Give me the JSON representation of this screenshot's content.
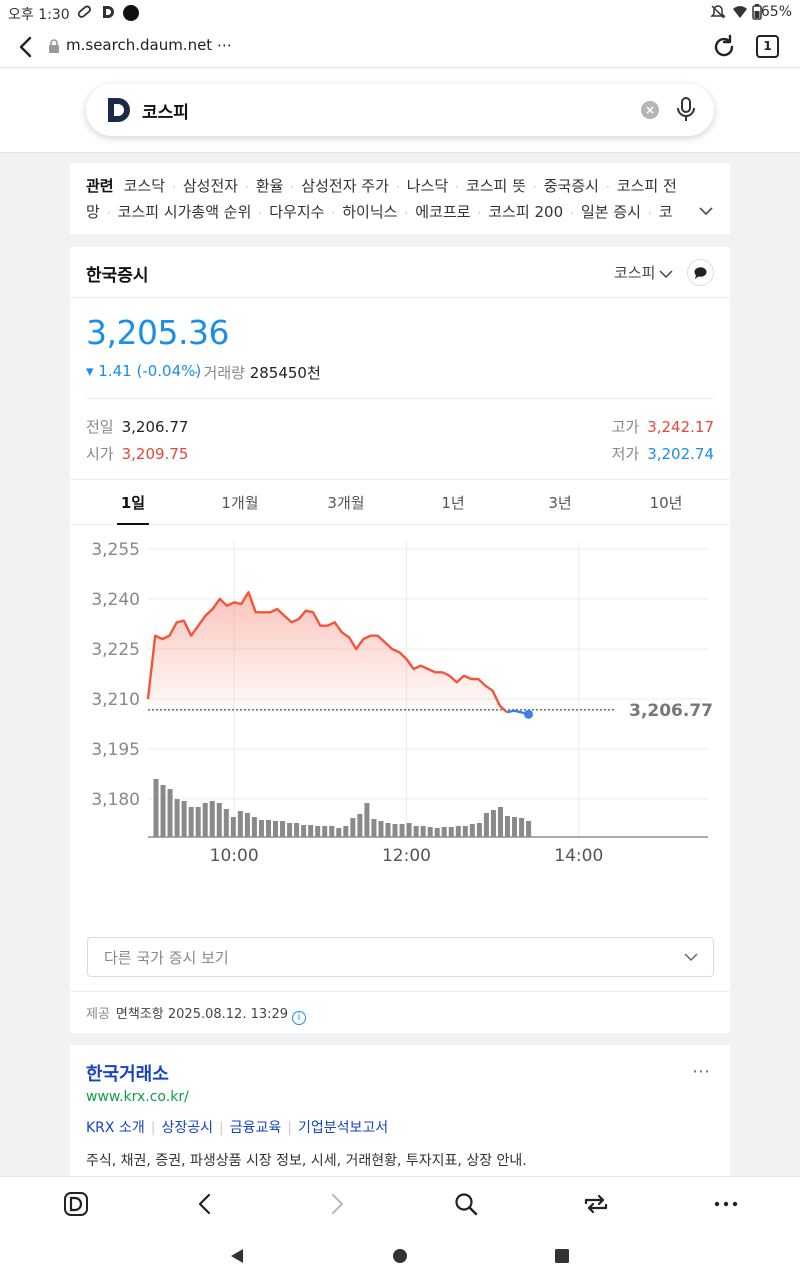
{
  "status_bar": {
    "time": "오후 1:30",
    "battery": "65%"
  },
  "browser": {
    "url": "m.search.daum.net ⋯",
    "tab_count": "1"
  },
  "search": {
    "query": "코스피"
  },
  "related": {
    "label": "관련",
    "line1": [
      "코스닥",
      "삼성전자",
      "환율",
      "삼성전자 주가",
      "나스닥",
      "코스피 뜻",
      "중국증시",
      "코스피 전"
    ],
    "line2": [
      "망",
      "코스피 시가총액 순위",
      "다우지수",
      "하이닉스",
      "에코프로",
      "코스피 200",
      "일본 증시",
      "코"
    ]
  },
  "market": {
    "title": "한국증시",
    "index_selector": "코스피",
    "price": "3,205.36",
    "change": "▾ 1.41 (-0.04%)",
    "volume_label": "· 거래량",
    "volume_value": "285450천",
    "prev_close_label": "전일",
    "prev_close": "3,206.77",
    "open_label": "시가",
    "open": "3,209.75",
    "high_label": "고가",
    "high": "3,242.17",
    "low_label": "저가",
    "low": "3,202.74",
    "tabs": [
      "1일",
      "1개월",
      "3개월",
      "1년",
      "3년",
      "10년"
    ],
    "other_markets": "다른 국가 증시 보기",
    "provider_label": "제공",
    "provider_value": "면책조항 2025.08.12. 13:29"
  },
  "chart_data": {
    "type": "line",
    "x_ticks": [
      "10:00",
      "12:00",
      "14:00"
    ],
    "y_ticks": [
      "3,255",
      "3,240",
      "3,225",
      "3,210",
      "3,195",
      "3,180"
    ],
    "ylim": [
      3180,
      3255
    ],
    "x_range_minutes": [
      540,
      930
    ],
    "reference_label": "3,206.77",
    "reference_value": 3206.77,
    "series": [
      {
        "points": [
          [
            540,
            3210
          ],
          [
            545,
            3229
          ],
          [
            550,
            3228
          ],
          [
            555,
            3229
          ],
          [
            560,
            3233
          ],
          [
            565,
            3233.5
          ],
          [
            570,
            3229
          ],
          [
            575,
            3232
          ],
          [
            580,
            3235
          ],
          [
            585,
            3237
          ],
          [
            590,
            3240
          ],
          [
            595,
            3238
          ],
          [
            600,
            3239
          ],
          [
            605,
            3238.5
          ],
          [
            610,
            3242
          ],
          [
            615,
            3236
          ],
          [
            620,
            3236
          ],
          [
            625,
            3236
          ],
          [
            630,
            3237
          ],
          [
            635,
            3235
          ],
          [
            640,
            3233
          ],
          [
            645,
            3234
          ],
          [
            650,
            3236.5
          ],
          [
            655,
            3236
          ],
          [
            660,
            3232
          ],
          [
            665,
            3232
          ],
          [
            670,
            3233
          ],
          [
            675,
            3230
          ],
          [
            680,
            3228.5
          ],
          [
            685,
            3225
          ],
          [
            690,
            3228
          ],
          [
            695,
            3229
          ],
          [
            700,
            3229
          ],
          [
            705,
            3227
          ],
          [
            710,
            3225
          ],
          [
            715,
            3224
          ],
          [
            720,
            3222
          ],
          [
            725,
            3219
          ],
          [
            730,
            3220
          ],
          [
            735,
            3219
          ],
          [
            740,
            3218
          ],
          [
            745,
            3218
          ],
          [
            750,
            3217
          ],
          [
            755,
            3215
          ],
          [
            760,
            3217
          ],
          [
            765,
            3216
          ],
          [
            770,
            3216
          ],
          [
            775,
            3214
          ],
          [
            780,
            3212.5
          ],
          [
            785,
            3208
          ],
          [
            790,
            3206
          ],
          [
            795,
            3206.5
          ],
          [
            800,
            3206
          ],
          [
            805,
            3205.4
          ]
        ]
      }
    ],
    "volume": [
      58,
      52,
      48,
      38,
      36,
      30,
      30,
      34,
      36,
      34,
      28,
      20,
      26,
      24,
      20,
      17,
      17,
      16,
      16,
      14,
      14,
      12,
      12,
      11,
      11,
      11,
      9,
      11,
      19,
      23,
      34,
      18,
      16,
      14,
      13,
      13,
      14,
      11,
      11,
      10,
      9,
      10,
      10,
      11,
      11,
      13,
      14,
      24,
      27,
      30,
      21,
      20,
      19,
      16
    ]
  }
}
